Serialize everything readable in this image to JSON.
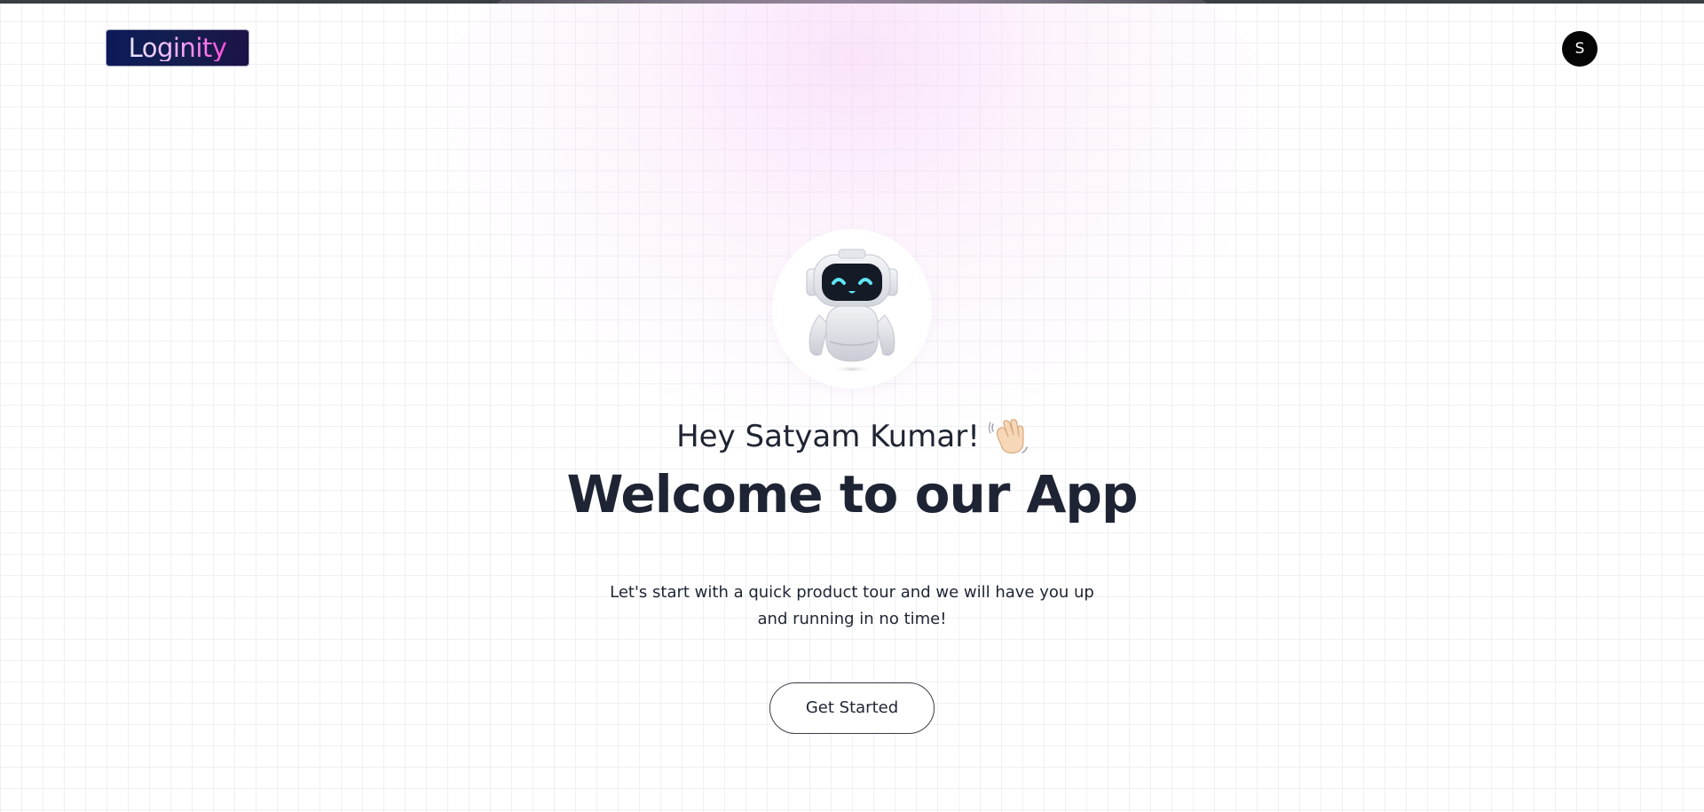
{
  "app": {
    "logo_text": "Loginity",
    "user_avatar_initial": "S"
  },
  "hero": {
    "greeting": "Hey Satyam Kumar!",
    "greeting_icon": "waving-hand-icon",
    "mascot_icon": "robot-mascot-icon",
    "title": "Welcome to our App",
    "subtitle": "Let's start with a quick product tour and we will have you up and running in no time!",
    "cta_label": "Get Started"
  },
  "colors": {
    "text_primary": "#1e2433",
    "avatar_bg": "#050505",
    "logo_bg": "#0c1a58",
    "logo_text_accent": "#ff4dd8",
    "glow": "#f6cef6"
  }
}
